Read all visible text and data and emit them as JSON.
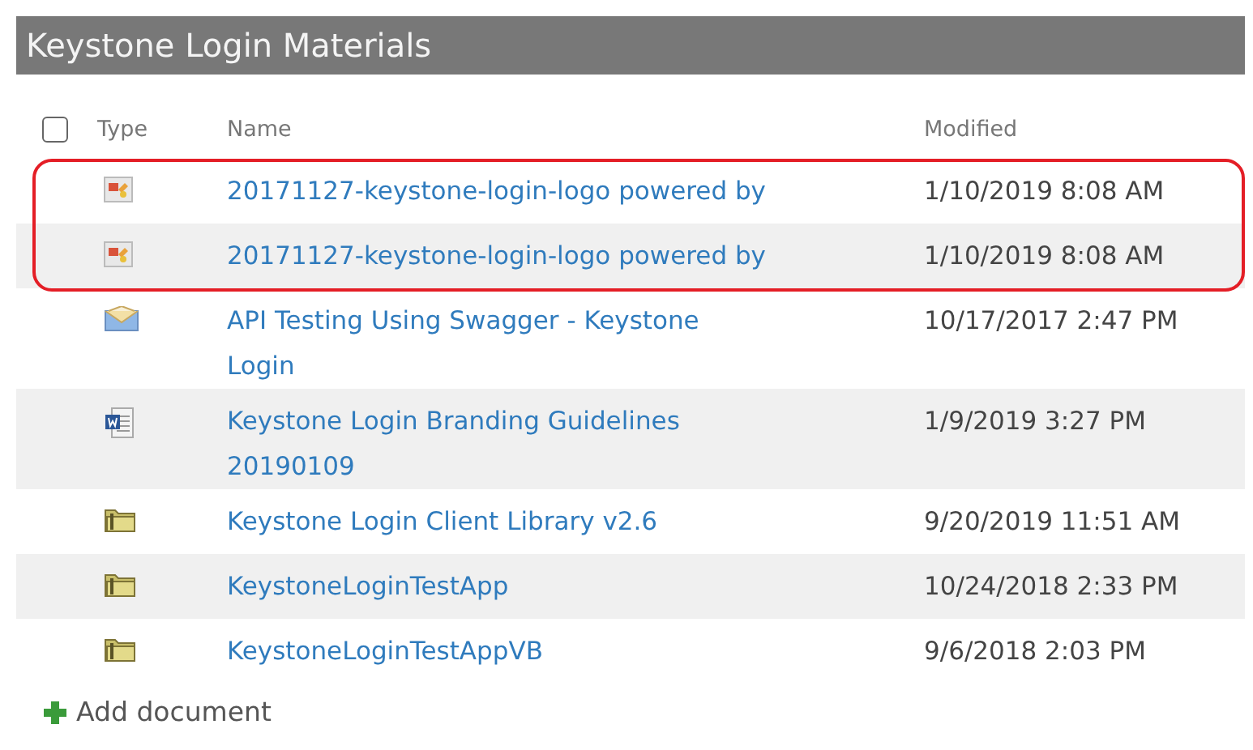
{
  "library": {
    "title": "Keystone Login Materials"
  },
  "select_all": {
    "checked": false
  },
  "columns": [
    "Type",
    "Name",
    "Modified"
  ],
  "rows": [
    {
      "kind": "image",
      "name": "20171127-keystone-login-logo powered by",
      "modified": "1/10/2019 8:08 AM",
      "highlighted": true
    },
    {
      "kind": "image",
      "name": "20171127-keystone-login-logo powered by",
      "modified": "1/10/2019 8:08 AM",
      "highlighted": true
    },
    {
      "kind": "message",
      "name": "API Testing Using Swagger - Keystone\nLogin",
      "modified": "10/17/2017 2:47 PM",
      "highlighted": false
    },
    {
      "kind": "word",
      "name": "Keystone Login Branding Guidelines\n20190109",
      "modified": "1/9/2019 3:27 PM",
      "highlighted": false
    },
    {
      "kind": "folder",
      "name": "Keystone Login Client Library v2.6",
      "modified": "9/20/2019 11:51 AM",
      "highlighted": false
    },
    {
      "kind": "folder",
      "name": "KeystoneLoginTestApp",
      "modified": "10/24/2018 2:33 PM",
      "highlighted": false
    },
    {
      "kind": "folder",
      "name": "KeystoneLoginTestAppVB",
      "modified": "9/6/2018 2:03 PM",
      "highlighted": false
    }
  ],
  "add_link": "Add document"
}
